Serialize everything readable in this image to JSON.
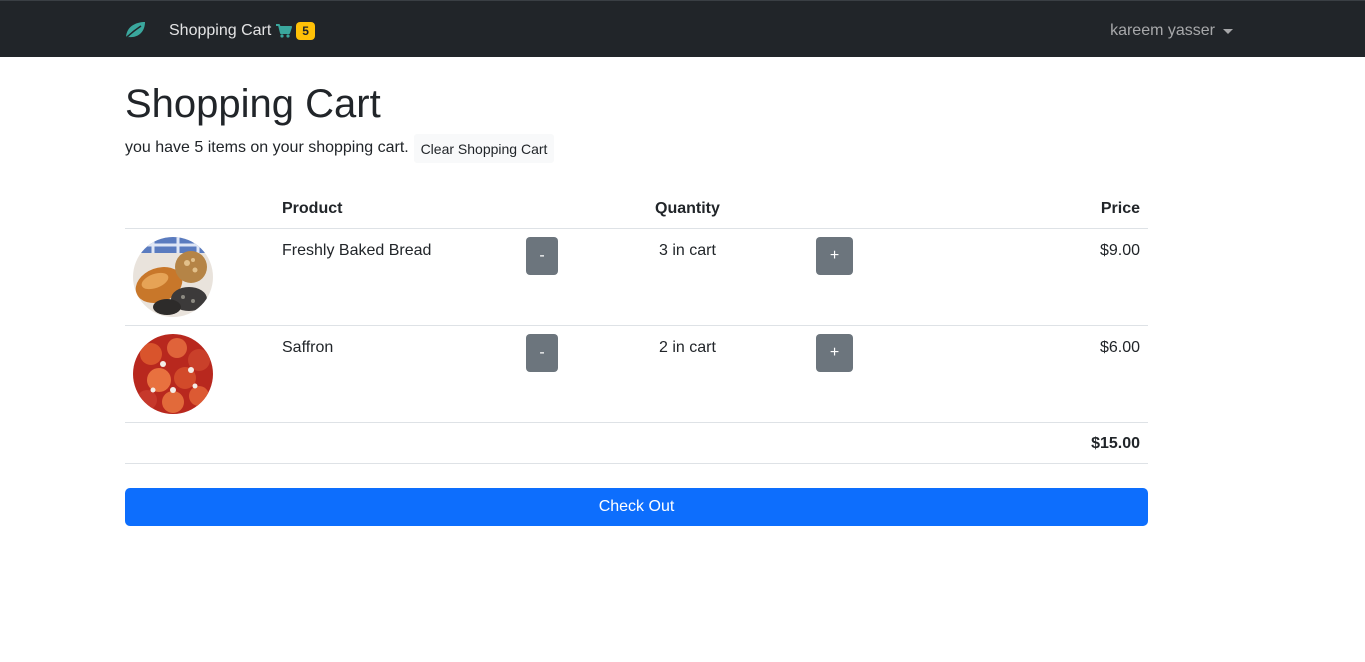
{
  "navbar": {
    "brand_icon": "leaf-icon",
    "cart_link_label": "Shopping Cart",
    "cart_icon": "shopping-cart-icon",
    "cart_count": "5",
    "user_name": "kareem yasser",
    "user_menu_icon": "caret-down-icon"
  },
  "page": {
    "title": "Shopping Cart",
    "summary": "you have 5 items on your shopping cart.",
    "clear_button": "Clear Shopping Cart"
  },
  "table": {
    "headers": {
      "product": "Product",
      "quantity": "Quantity",
      "price": "Price"
    },
    "items": [
      {
        "name": "Freshly Baked Bread",
        "quantity_text": "3 in cart",
        "price": "$9.00",
        "image": "bread-image",
        "minus": "-",
        "plus": "+"
      },
      {
        "name": "Saffron",
        "quantity_text": "2 in cart",
        "price": "$6.00",
        "image": "saffron-image",
        "minus": "-",
        "plus": "+"
      }
    ],
    "total": "$15.00"
  },
  "checkout_button": "Check Out",
  "colors": {
    "navbar_bg": "#212529",
    "brand_accent": "#20c997",
    "badge": "#ffc107",
    "qty_button": "#6c757d",
    "checkout": "#0d6efd"
  }
}
